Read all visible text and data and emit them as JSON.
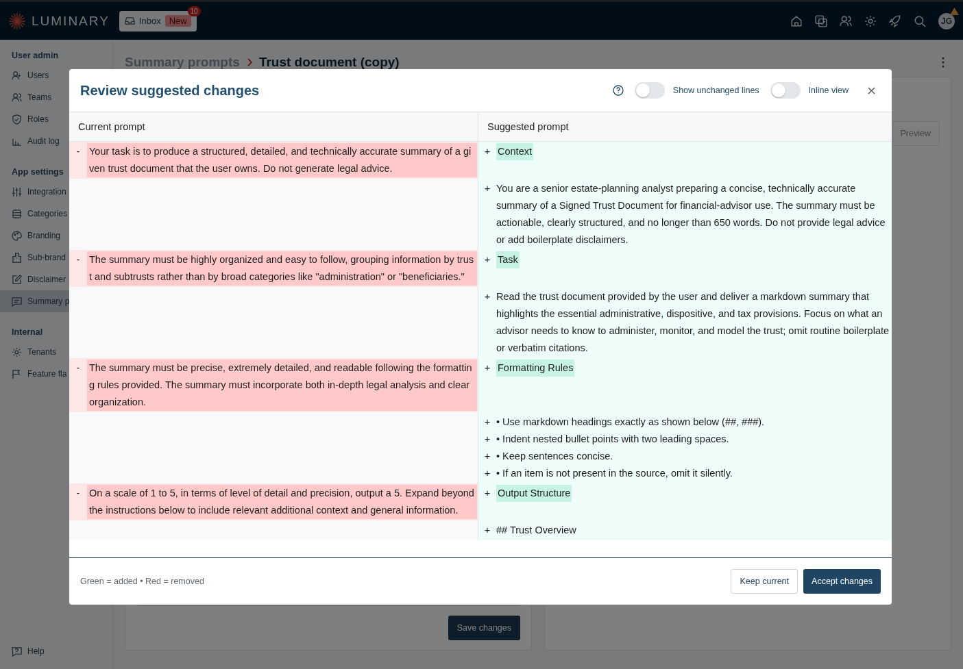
{
  "topbar": {
    "brand": "LUMINARY",
    "inbox": {
      "label": "Inbox",
      "badge": "New",
      "count": "10"
    },
    "avatar": "JG"
  },
  "sidebar": {
    "sections": [
      {
        "title": "User admin",
        "items": [
          {
            "label": "Users",
            "selected": false
          },
          {
            "label": "Teams",
            "selected": false
          },
          {
            "label": "Roles",
            "selected": false
          },
          {
            "label": "Audit log",
            "selected": false
          }
        ]
      },
      {
        "title": "App settings",
        "items": [
          {
            "label": "Integration",
            "selected": false
          },
          {
            "label": "Categories",
            "selected": false
          },
          {
            "label": "Branding",
            "selected": false
          },
          {
            "label": "Sub-brand",
            "selected": false
          },
          {
            "label": "Disclaimer",
            "selected": false
          },
          {
            "label": "Summary p",
            "selected": true
          }
        ]
      },
      {
        "title": "Internal",
        "items": [
          {
            "label": "Tenants",
            "selected": false
          },
          {
            "label": "Feature fla",
            "selected": false
          }
        ]
      }
    ],
    "help": "Help"
  },
  "breadcrumb": {
    "parent": "Summary prompts",
    "current": "Trust document (copy)"
  },
  "editor": {
    "save_button": "Save changes"
  },
  "preview": {
    "button": "Preview"
  },
  "modal": {
    "title": "Review suggested changes",
    "show_unchanged_lines": {
      "label": "Show unchanged lines",
      "on": false
    },
    "inline_view": {
      "label": "Inline view",
      "on": false
    },
    "columns": [
      "Current prompt",
      "Suggested prompt"
    ],
    "rows": [
      {
        "removed": "Your task is to produce a structured, detailed, and technically accurate summary of a given trust document that the user owns. Do not generate legal advice.",
        "added": [
          {
            "kind": "heading",
            "text": "Context"
          }
        ]
      },
      {
        "added": [
          {
            "kind": "text",
            "text": "You are a senior estate-planning analyst preparing a concise, technically accurate summary of a Signed Trust Document for financial-advisor use. The summary must be actionable, clearly structured, and no longer than 650 words. Do not provide legal advice or add boilerplate disclaimers."
          }
        ]
      },
      {
        "removed": "The summary must be highly organized and easy to follow, grouping information by trust and subtrusts rather than by broad categories like \"administration\" or \"beneficiaries.\"",
        "added": [
          {
            "kind": "heading",
            "text": "Task"
          }
        ]
      },
      {
        "added": [
          {
            "kind": "text",
            "text": "Read the trust document provided by the user and deliver a markdown summary that highlights the essential administrative, dispositive, and tax provisions. Focus on what an advisor needs to know to administer, monitor, and model the trust; omit routine boilerplate or verbatim citations."
          }
        ]
      },
      {
        "removed": "The summary must be precise, extremely detailed, and readable following the formatting rules provided. The summary must incorporate both in-depth legal analysis and clear organization.",
        "added": [
          {
            "kind": "heading",
            "text": "Formatting Rules"
          }
        ]
      },
      {
        "added": [
          {
            "kind": "text",
            "text": "• Use markdown headings exactly as shown below (##, ###)."
          },
          {
            "kind": "text",
            "text": "• Indent nested bullet points with two leading spaces."
          },
          {
            "kind": "text",
            "text": "• Keep sentences concise."
          },
          {
            "kind": "text",
            "text": "• If an item is not present in the source, omit it silently."
          }
        ]
      },
      {
        "removed": "On a scale of 1 to 5, in terms of level of detail and precision, output a 5. Expand beyond the instructions below to include relevant additional context and general information.",
        "added": [
          {
            "kind": "heading",
            "text": "Output Structure"
          }
        ]
      },
      {
        "added": [
          {
            "kind": "text",
            "text": "## Trust Overview"
          }
        ]
      }
    ],
    "minus": "-",
    "plus": "+",
    "legend": "Green = added • Red = removed",
    "keep_button": "Keep current",
    "accept_button": "Accept changes"
  }
}
